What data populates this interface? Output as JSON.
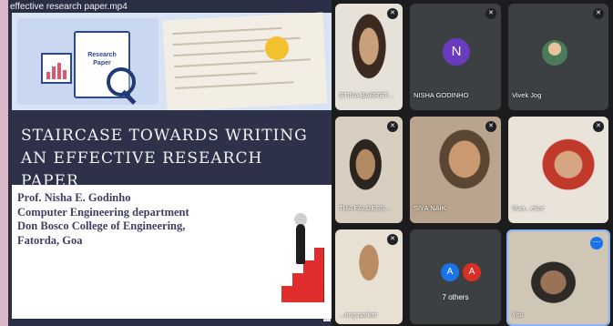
{
  "presentation": {
    "title": "effective research paper.mp4",
    "illustration_label": "Research Paper",
    "slide_heading": "STAIRCASE TOWARDS WRITING AN EFFECTIVE RESEARCH PAPER",
    "author_lines": [
      "Prof. Nisha E. Godinho",
      "Computer Engineering department",
      "Don Bosco College of Engineering,",
      "Fatorda, Goa"
    ]
  },
  "participants": [
    {
      "name": "STINA BARRET..."
    },
    {
      "name": "NISHA GODINHO",
      "initial": "N"
    },
    {
      "name": "Vivek Jog"
    },
    {
      "name": "THA FALDESS..."
    },
    {
      "name": "SIYA NAIK"
    },
    {
      "name": "Swa...ekar"
    },
    {
      "name": "...ang parkar"
    },
    {
      "name": "7 others",
      "initials": [
        "A",
        "A"
      ]
    },
    {
      "name": "You"
    }
  ],
  "icons": {
    "mic_off": "mic-off-icon",
    "more": "more-options-icon"
  },
  "colors": {
    "heading_bg": "#2d3149",
    "avatar_purple": "#6a3bbf",
    "avatar_blue": "#1a73e8",
    "avatar_red": "#d93025",
    "tile_bg": "#3c4043",
    "active_border": "#8ab4f8"
  }
}
